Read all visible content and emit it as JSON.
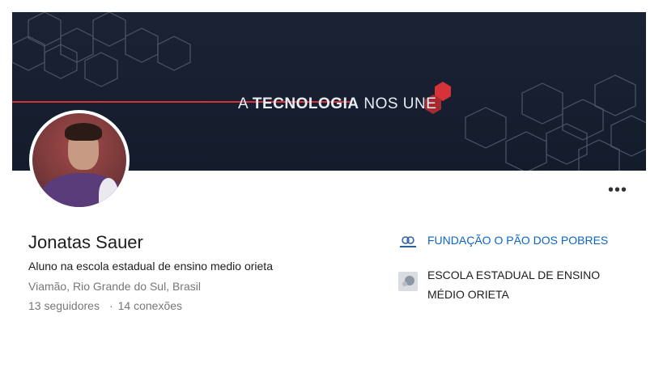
{
  "banner": {
    "tagline_prefix": "A ",
    "tagline_strong": "TECNOLOGIA",
    "tagline_suffix": " NOS UNE",
    "accent_color": "#d5323a",
    "background_color": "#172031"
  },
  "profile": {
    "name": "Jonatas Sauer",
    "headline": "Aluno na escola estadual de ensino medio orieta",
    "location": "Viamão, Rio Grande do Sul, Brasil",
    "followers": "13 seguidores",
    "separator": "·",
    "connections": "14 conexões"
  },
  "actions": {
    "more_label": "•••"
  },
  "organizations": [
    {
      "name": "FUNDAÇÃO O PÃO DOS POBRES",
      "icon": "pao-dos-pobres-logo",
      "link_color": "#0a66c2"
    },
    {
      "name": "ESCOLA ESTADUAL DE ENSINO MÉDIO ORIETA",
      "icon": "school-logo-placeholder"
    }
  ]
}
